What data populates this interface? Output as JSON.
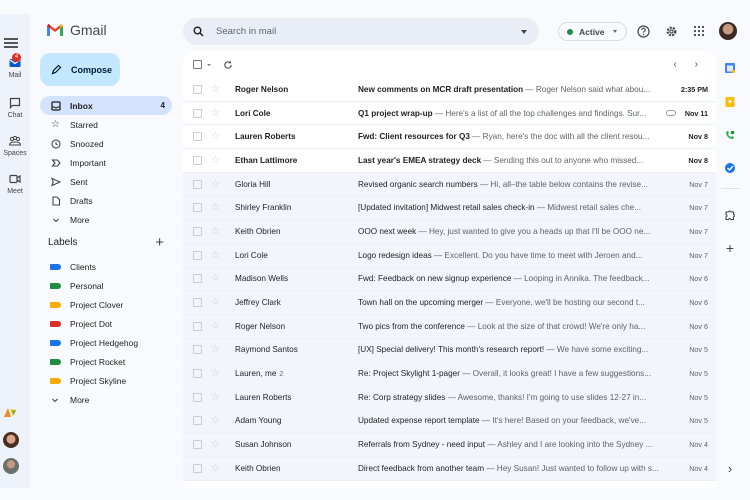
{
  "app": {
    "name": "Gmail"
  },
  "rail": {
    "items": [
      {
        "label": "Mail",
        "icon": "mail-icon",
        "badge": "4"
      },
      {
        "label": "Chat",
        "icon": "chat-icon"
      },
      {
        "label": "Spaces",
        "icon": "spaces-icon"
      },
      {
        "label": "Meet",
        "icon": "meet-icon"
      }
    ]
  },
  "compose": {
    "label": "Compose"
  },
  "nav": [
    {
      "label": "Inbox",
      "icon": "inbox-icon",
      "count": "4",
      "active": true
    },
    {
      "label": "Starred",
      "icon": "star-icon"
    },
    {
      "label": "Snoozed",
      "icon": "clock-icon"
    },
    {
      "label": "Important",
      "icon": "important-icon"
    },
    {
      "label": "Sent",
      "icon": "send-icon"
    },
    {
      "label": "Drafts",
      "icon": "draft-icon"
    },
    {
      "label": "More",
      "icon": "chevron-down-icon"
    }
  ],
  "labels": {
    "title": "Labels",
    "items": [
      {
        "label": "Clients",
        "color": "#1a73e8"
      },
      {
        "label": "Personal",
        "color": "#1e8e3e"
      },
      {
        "label": "Project Clover",
        "color": "#f9ab00"
      },
      {
        "label": "Project Dot",
        "color": "#d93025"
      },
      {
        "label": "Project Hedgehog",
        "color": "#1a73e8"
      },
      {
        "label": "Project Rocket",
        "color": "#1e8e3e"
      },
      {
        "label": "Project Skyline",
        "color": "#f9ab00"
      }
    ],
    "more": "More"
  },
  "search": {
    "placeholder": "Search in mail"
  },
  "status": {
    "label": "Active",
    "color": "#1e8e3e"
  },
  "emails": [
    {
      "sender": "Roger Nelson",
      "subject": "New comments on MCR draft presentation",
      "snippet": " — Roger Nelson said what abou...",
      "date": "2:35 PM",
      "unread": true
    },
    {
      "sender": "Lori Cole",
      "subject": "Q1 project wrap-up",
      "snippet": " — Here's a list of all the top challenges and findings. Sur...",
      "date": "Nov 11",
      "unread": true,
      "attachment": true
    },
    {
      "sender": "Lauren Roberts",
      "subject": "Fwd: Client resources for Q3",
      "snippet": " — Ryan, here's the doc with all the client resou...",
      "date": "Nov 8",
      "unread": true
    },
    {
      "sender": "Ethan Lattimore",
      "subject": "Last year's EMEA strategy deck",
      "snippet": " — Sending this out to anyone who missed...",
      "date": "Nov 8",
      "unread": true
    },
    {
      "sender": "Gloria Hill",
      "subject": "Revised organic search numbers",
      "snippet": " — Hi, all–the table below contains the revise...",
      "date": "Nov 7"
    },
    {
      "sender": "Shirley Franklin",
      "subject": "[Updated invitation] Midwest retail sales check-in",
      "snippet": " — Midwest retail sales che...",
      "date": "Nov 7"
    },
    {
      "sender": "Keith Obrien",
      "subject": "OOO next week",
      "snippet": " — Hey, just wanted to give you a heads up that I'll be OOO ne...",
      "date": "Nov 7"
    },
    {
      "sender": "Lori Cole",
      "subject": "Logo redesign ideas",
      "snippet": " — Excellent. Do you have time to meet with Jeroen and...",
      "date": "Nov 7"
    },
    {
      "sender": "Madison Wells",
      "subject": "Fwd: Feedback on new signup experience",
      "snippet": " — Looping in Annika. The feedback...",
      "date": "Nov 6"
    },
    {
      "sender": "Jeffrey Clark",
      "subject": "Town hall on the upcoming merger",
      "snippet": " — Everyone, we'll be hosting our second t...",
      "date": "Nov 6"
    },
    {
      "sender": "Roger Nelson",
      "subject": "Two pics from the conference",
      "snippet": " — Look at the size of that crowd! We're only ha...",
      "date": "Nov 6"
    },
    {
      "sender": "Raymond Santos",
      "subject": "[UX] Special delivery! This month's research report!",
      "snippet": " — We have some exciting...",
      "date": "Nov 5"
    },
    {
      "sender": "Lauren, me",
      "count": "2",
      "subject": "Re: Project Skylight 1-pager",
      "snippet": " — Overall, it looks great! I have a few suggestions...",
      "date": "Nov 5"
    },
    {
      "sender": "Lauren Roberts",
      "subject": "Re: Corp strategy slides",
      "snippet": " — Awesome, thanks! I'm going to use slides 12-27 in...",
      "date": "Nov 5"
    },
    {
      "sender": "Adam Young",
      "subject": "Updated expense report template",
      "snippet": " — It's here! Based on your feedback, we've...",
      "date": "Nov 5"
    },
    {
      "sender": "Susan Johnson",
      "subject": "Referrals from Sydney - need input",
      "snippet": " — Ashley and I are looking into the Sydney ...",
      "date": "Nov 4"
    },
    {
      "sender": "Keith Obrien",
      "subject": "Direct feedback from another team",
      "snippet": " — Hey Susan! Just wanted to follow up with s...",
      "date": "Nov 4"
    }
  ],
  "side_panel": [
    "calendar-icon",
    "keep-icon",
    "contacts-icon",
    "tasks-icon",
    "addons-icon",
    "add-icon"
  ]
}
